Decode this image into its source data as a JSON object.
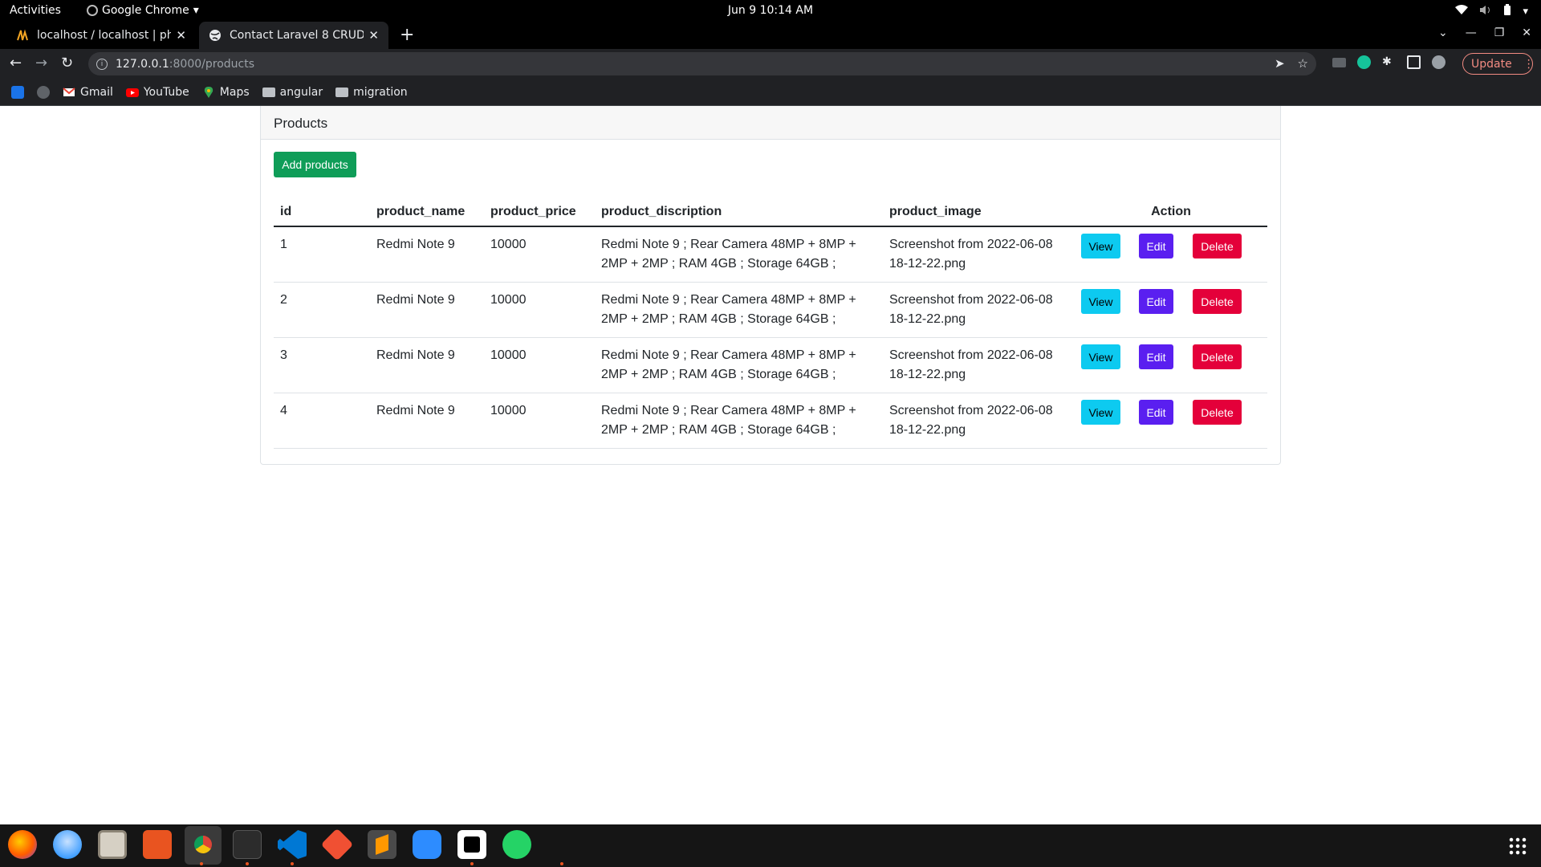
{
  "topbar": {
    "activities": "Activities",
    "app_name": "Google Chrome",
    "clock": "Jun 9  10:14 AM"
  },
  "tabs": [
    {
      "title": "localhost / localhost | php",
      "active": false
    },
    {
      "title": "Contact Laravel 8 CRUD",
      "active": true
    }
  ],
  "omnibox": {
    "host": "127.0.0.1",
    "path": ":8000/products"
  },
  "toolbar": {
    "update_label": "Update"
  },
  "bookmarks": [
    {
      "label": "Gmail",
      "icon": "gmail-icon"
    },
    {
      "label": "YouTube",
      "icon": "youtube-icon"
    },
    {
      "label": "Maps",
      "icon": "maps-icon"
    },
    {
      "label": "angular",
      "icon": "folder-icon"
    },
    {
      "label": "migration",
      "icon": "folder-icon"
    }
  ],
  "card": {
    "header": "Products",
    "add_button": "Add products"
  },
  "table": {
    "headers": {
      "id": "id",
      "name": "product_name",
      "price": "product_price",
      "description": "product_discription",
      "image": "product_image",
      "action": "Action"
    },
    "rows": [
      {
        "id": "1",
        "name": "Redmi Note 9",
        "price": "10000",
        "desc_line1": "Redmi Note 9 ; Rear Camera 48MP + 8MP +",
        "desc_line2": "2MP + 2MP ; RAM 4GB ; Storage 64GB ;",
        "image_line1": "Screenshot from 2022-06-08",
        "image_line2": "18-12-22.png"
      },
      {
        "id": "2",
        "name": "Redmi Note 9",
        "price": "10000",
        "desc_line1": "Redmi Note 9 ; Rear Camera 48MP + 8MP +",
        "desc_line2": "2MP + 2MP ; RAM 4GB ; Storage 64GB ;",
        "image_line1": "Screenshot from 2022-06-08",
        "image_line2": "18-12-22.png"
      },
      {
        "id": "3",
        "name": "Redmi Note 9",
        "price": "10000",
        "desc_line1": "Redmi Note 9 ; Rear Camera 48MP + 8MP +",
        "desc_line2": "2MP + 2MP ; RAM 4GB ; Storage 64GB ;",
        "image_line1": "Screenshot from 2022-06-08",
        "image_line2": "18-12-22.png"
      },
      {
        "id": "4",
        "name": "Redmi Note 9",
        "price": "10000",
        "desc_line1": "Redmi Note 9 ; Rear Camera 48MP + 8MP +",
        "desc_line2": "2MP + 2MP ; RAM 4GB ; Storage 64GB ;",
        "image_line1": "Screenshot from 2022-06-08",
        "image_line2": "18-12-22.png"
      }
    ],
    "actions": {
      "view": "View",
      "edit": "Edit",
      "delete": "Delete"
    }
  },
  "colors": {
    "add": "#0f9d58",
    "view": "#0dcaf0",
    "edit": "#5a1ff0",
    "delete": "#e4003a"
  },
  "dock_icons": [
    "firefox-icon",
    "thunderbird-icon",
    "files-icon",
    "software-icon",
    "chrome-icon",
    "terminal-icon",
    "vscode-icon",
    "git-icon",
    "sublime-icon",
    "zoom-icon",
    "inkscape-icon",
    "whatsapp-icon"
  ]
}
